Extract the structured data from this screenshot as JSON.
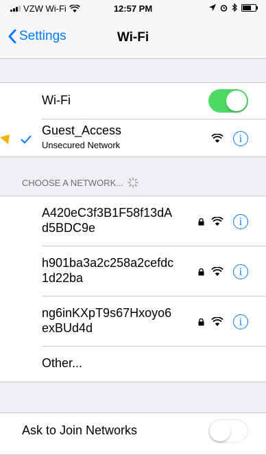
{
  "status_bar": {
    "carrier": "VZW Wi-Fi",
    "time": "12:57 PM"
  },
  "nav": {
    "back_label": "Settings",
    "title": "Wi-Fi"
  },
  "wifi_toggle": {
    "label": "Wi-Fi",
    "state": "on"
  },
  "connected": {
    "name": "Guest_Access",
    "subtitle": "Unsecured Network"
  },
  "section": {
    "header": "CHOOSE A NETWORK..."
  },
  "networks": [
    {
      "name_line1": "A420eC3f3B1F58f13dA",
      "name_line2": "d5BDC9e",
      "secured": true
    },
    {
      "name_line1": "h901ba3a2c258a2cefdc",
      "name_line2": "1d22ba",
      "secured": true
    },
    {
      "name_line1": "ng6inKXpT9s67Hxoyo6",
      "name_line2": "exBUd4d",
      "secured": true
    }
  ],
  "other_label": "Other...",
  "ask_join": {
    "label": "Ask to Join Networks",
    "state": "off"
  },
  "colors": {
    "accent": "#007aff",
    "toggle_on": "#4cd964",
    "arrow": "#f5b400"
  },
  "icons": {
    "info": "info-icon",
    "wifi": "wifi-signal-icon",
    "lock": "lock-icon",
    "check": "checkmark-icon",
    "back": "chevron-left-icon"
  }
}
